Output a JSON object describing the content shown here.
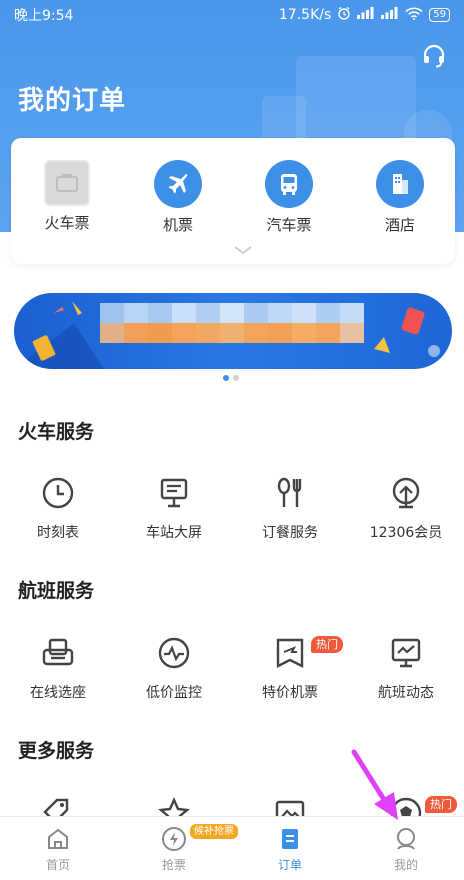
{
  "status_bar": {
    "time": "晚上9:54",
    "speed": "17.5K/s",
    "battery": "59"
  },
  "header": {
    "title": "我的订单",
    "background_color": "#4a97ec"
  },
  "categories": [
    {
      "label": "火车票",
      "icon": "train-ticket-icon"
    },
    {
      "label": "机票",
      "icon": "airplane-icon"
    },
    {
      "label": "汽车票",
      "icon": "bus-icon"
    },
    {
      "label": "酒店",
      "icon": "hotel-icon"
    }
  ],
  "banner": {
    "carousel_pages": 2,
    "active_page": 1
  },
  "sections": {
    "train": {
      "title": "火车服务",
      "items": [
        {
          "label": "时刻表",
          "icon": "clock-icon"
        },
        {
          "label": "车站大屏",
          "icon": "monitor-icon"
        },
        {
          "label": "订餐服务",
          "icon": "utensils-icon"
        },
        {
          "label": "12306会员",
          "icon": "member-icon"
        }
      ]
    },
    "flight": {
      "title": "航班服务",
      "items": [
        {
          "label": "在线选座",
          "icon": "seat-icon"
        },
        {
          "label": "低价监控",
          "icon": "price-monitor-icon"
        },
        {
          "label": "特价机票",
          "icon": "special-ticket-icon",
          "badge": "热门"
        },
        {
          "label": "航班动态",
          "icon": "flight-status-icon"
        }
      ]
    },
    "more": {
      "title": "更多服务",
      "items": [
        {
          "icon": "tag-icon"
        },
        {
          "icon": "star-icon"
        },
        {
          "icon": "image-icon"
        },
        {
          "icon": "ball-icon",
          "badge": "热门"
        }
      ]
    }
  },
  "tabbar": {
    "items": [
      {
        "label": "首页",
        "icon": "home-icon"
      },
      {
        "label": "抢票",
        "icon": "lightning-icon",
        "badge": "候补抢票"
      },
      {
        "label": "订单",
        "icon": "order-icon",
        "active": true
      },
      {
        "label": "我的",
        "icon": "profile-icon"
      }
    ]
  },
  "colors": {
    "accent": "#3d8fe8",
    "hot_badge": "#f05a3a",
    "tab_badge": "#f5a623",
    "pointer": "#e040fb"
  }
}
